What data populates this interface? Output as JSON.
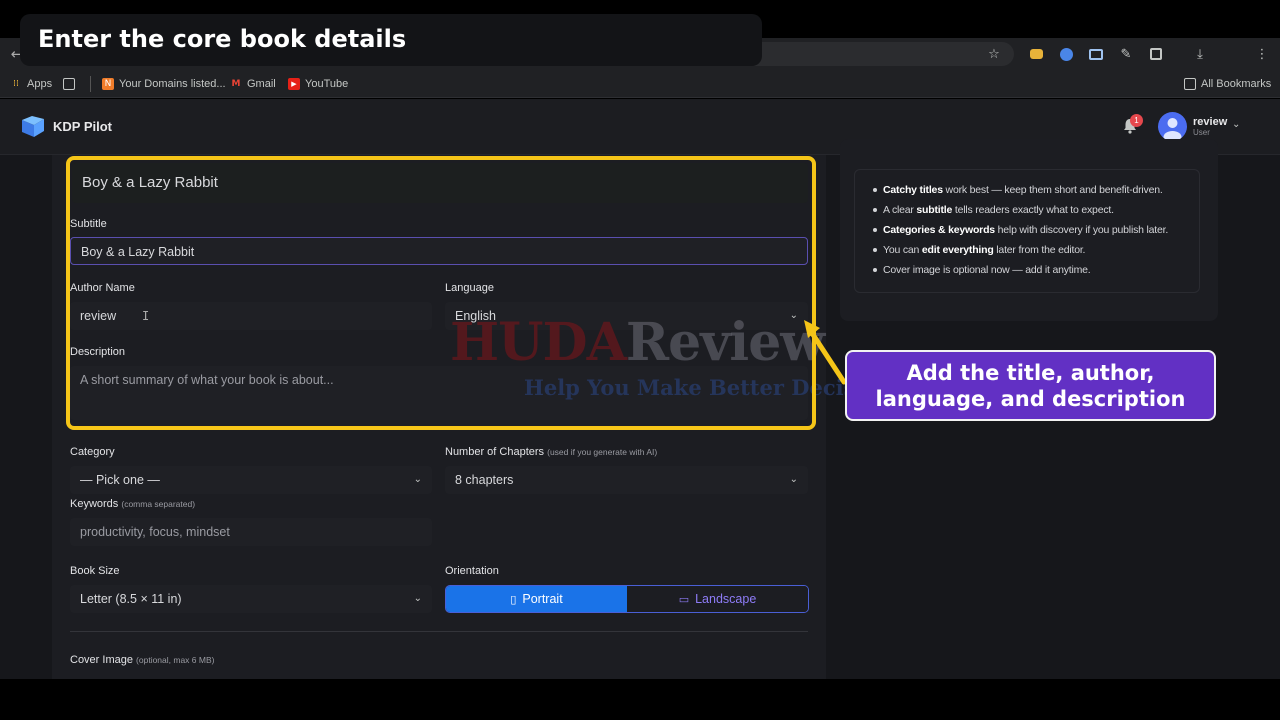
{
  "browser": {
    "bookmarks": [
      {
        "label": "Apps"
      },
      {
        "label": "Your Domains listed..."
      },
      {
        "label": "Gmail"
      },
      {
        "label": "YouTube"
      }
    ],
    "all_bookmarks": "All Bookmarks"
  },
  "app": {
    "name": "KDP Pilot",
    "notifications": "1",
    "user": {
      "name": "review",
      "role": "User"
    }
  },
  "form": {
    "title_value": "Boy & a Lazy Rabbit",
    "subtitle_label": "Subtitle",
    "subtitle_value": "Boy & a Lazy Rabbit",
    "author_label": "Author Name",
    "author_value": "review",
    "language_label": "Language",
    "language_value": "English",
    "description_label": "Description",
    "description_placeholder": "A short summary of what your book is about...",
    "category_label": "Category",
    "category_value": "— Pick one —",
    "chapters_label": "Number of Chapters",
    "chapters_hint": "(used if you generate with AI)",
    "chapters_value": "8 chapters",
    "keywords_label": "Keywords",
    "keywords_hint": "(comma separated)",
    "keywords_placeholder": "productivity, focus, mindset",
    "booksize_label": "Book Size",
    "booksize_value": "Letter (8.5 × 11 in)",
    "orientation_label": "Orientation",
    "orientation_portrait": "Portrait",
    "orientation_landscape": "Landscape",
    "cover_label": "Cover Image",
    "cover_hint": "(optional, max 6 MB)"
  },
  "tips": [
    {
      "bold": "Catchy titles",
      "rest": " work best — keep them short and benefit-driven."
    },
    {
      "pre": "A clear ",
      "bold": "subtitle",
      "rest": " tells readers exactly what to expect."
    },
    {
      "bold": "Categories & keywords",
      "rest": " help with discovery if you publish later."
    },
    {
      "pre": "You can ",
      "bold": "edit everything",
      "rest": " later from the editor."
    },
    {
      "rest": "Cover image is optional now — add it anytime."
    }
  ],
  "watermark": {
    "brand_a": "HUDA",
    "brand_b": "Review",
    "tagline": "Help You Make Better Decisions"
  },
  "annotation": {
    "title": "Enter the core book details",
    "callout": "Add the title, author, language, and description"
  },
  "colors": {
    "highlight": "#f5c518",
    "callout_bg": "#6230c4",
    "accent": "#1a73e8"
  }
}
